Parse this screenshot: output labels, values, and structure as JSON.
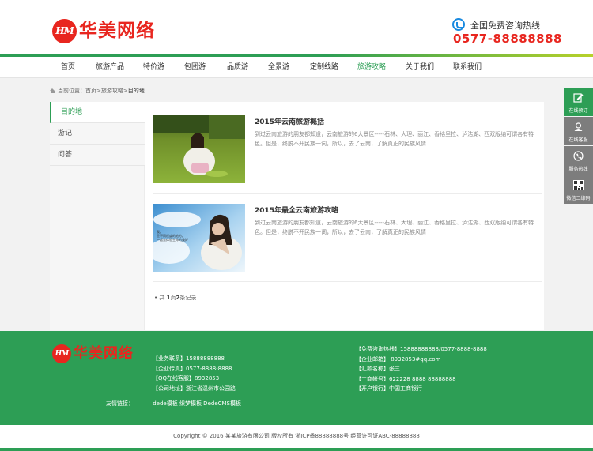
{
  "header": {
    "logo_mark": "HM",
    "logo_text": "华美网络",
    "hotline_label": "全国免费咨询热线",
    "hotline_number": "0577-88888888"
  },
  "nav": {
    "items": [
      "首页",
      "旅游产品",
      "特价游",
      "包团游",
      "品质游",
      "全景游",
      "定制线路",
      "旅游攻略",
      "关于我们",
      "联系我们"
    ],
    "active_index": 7
  },
  "breadcrumb": {
    "prefix": "当前位置：",
    "home": "首页",
    "sep1": " > ",
    "section": "旅游攻略",
    "sep2": " > ",
    "current": "目的地"
  },
  "sidebar": {
    "items": [
      "目的地",
      "游记",
      "问答"
    ],
    "active_index": 0
  },
  "articles": [
    {
      "title": "2015年云南旅游概括",
      "summary": "到过云南旅游的朋友都知道，云南旅游的6大景区-----石林、大理、丽江、香格里拉、泸沽湖、西双版纳可谓各有特色。但是，终脱不开民族一词，所以，去了云南，了解真正的民族风情"
    },
    {
      "title": "2015年最全云南旅游攻略",
      "summary": "到过云南旅游的朋友都知道，云南旅游的6大景区-----石林、大理、丽江、香格里拉、泸沽湖、西双版纳可谓各有特色。但是，终脱不开民族一词，所以，去了云南，了解真正的民族风情",
      "image_text": [
        "我。",
        "旦不同程度的地方。",
        "—起去体验生命的美好"
      ]
    }
  ],
  "pager": {
    "prefix": "共 ",
    "pages": "1",
    "mid": "页",
    "records": "2",
    "suffix": "条记录"
  },
  "float_bar": {
    "items": [
      {
        "label": "在线预订",
        "icon": "edit-icon"
      },
      {
        "label": "在线客服",
        "icon": "headset-icon"
      },
      {
        "label": "服务热线",
        "icon": "phone-icon"
      },
      {
        "label": "微信二维码",
        "icon": "qrcode-icon"
      }
    ]
  },
  "footer": {
    "left_info": [
      "【业务联系】15888888888",
      "【企业传真】0577-8888-8888",
      "【QQ在线客服】8932853",
      "【公司地址】浙江省温州市公园路"
    ],
    "right_info": [
      "【免费咨询热线】15888888888/0577-8888-8888",
      "【企业邮箱】 8932853#qq.com",
      "【汇款名称】张三",
      "【工商帐号】622228 8888 88888888",
      "【开户银行】中国工商银行"
    ],
    "links_label": "友情链接：",
    "links": "dede模板 织梦模板 DedeCMS模板"
  },
  "copyright": "Copyright © 2016   某某旅游有限公司   版权所有 浙ICP备88888888号   经营许可证ABC-88888888",
  "colors": {
    "brand_green": "#2d9e55",
    "logo_red": "#e8261f",
    "hotline_blue": "#1a8ae0"
  }
}
